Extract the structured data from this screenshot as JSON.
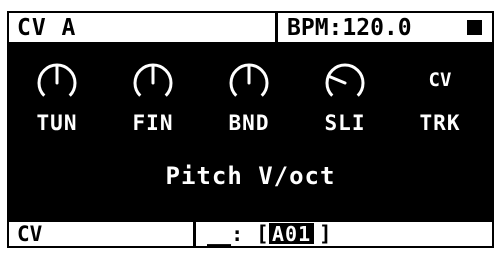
{
  "header": {
    "title": "CV A",
    "bpm": "BPM:120.0",
    "transport_icon": "stop-icon"
  },
  "knobs": [
    {
      "label": "TUN",
      "level": 0.5
    },
    {
      "label": "FIN",
      "level": 0.5
    },
    {
      "label": "BND",
      "level": 0.5
    },
    {
      "label": "SLI",
      "level": 0.25
    }
  ],
  "track": {
    "tag": "CV",
    "label": "TRK"
  },
  "mode": "Pitch V/oct",
  "footer": {
    "left": "CV",
    "prefix": "__:",
    "open_bracket": "[",
    "value": "A01",
    "close_bracket": "]"
  },
  "colors": {
    "panel": "#000000",
    "text_on_panel": "#ffffff",
    "background": "#ffffff"
  }
}
